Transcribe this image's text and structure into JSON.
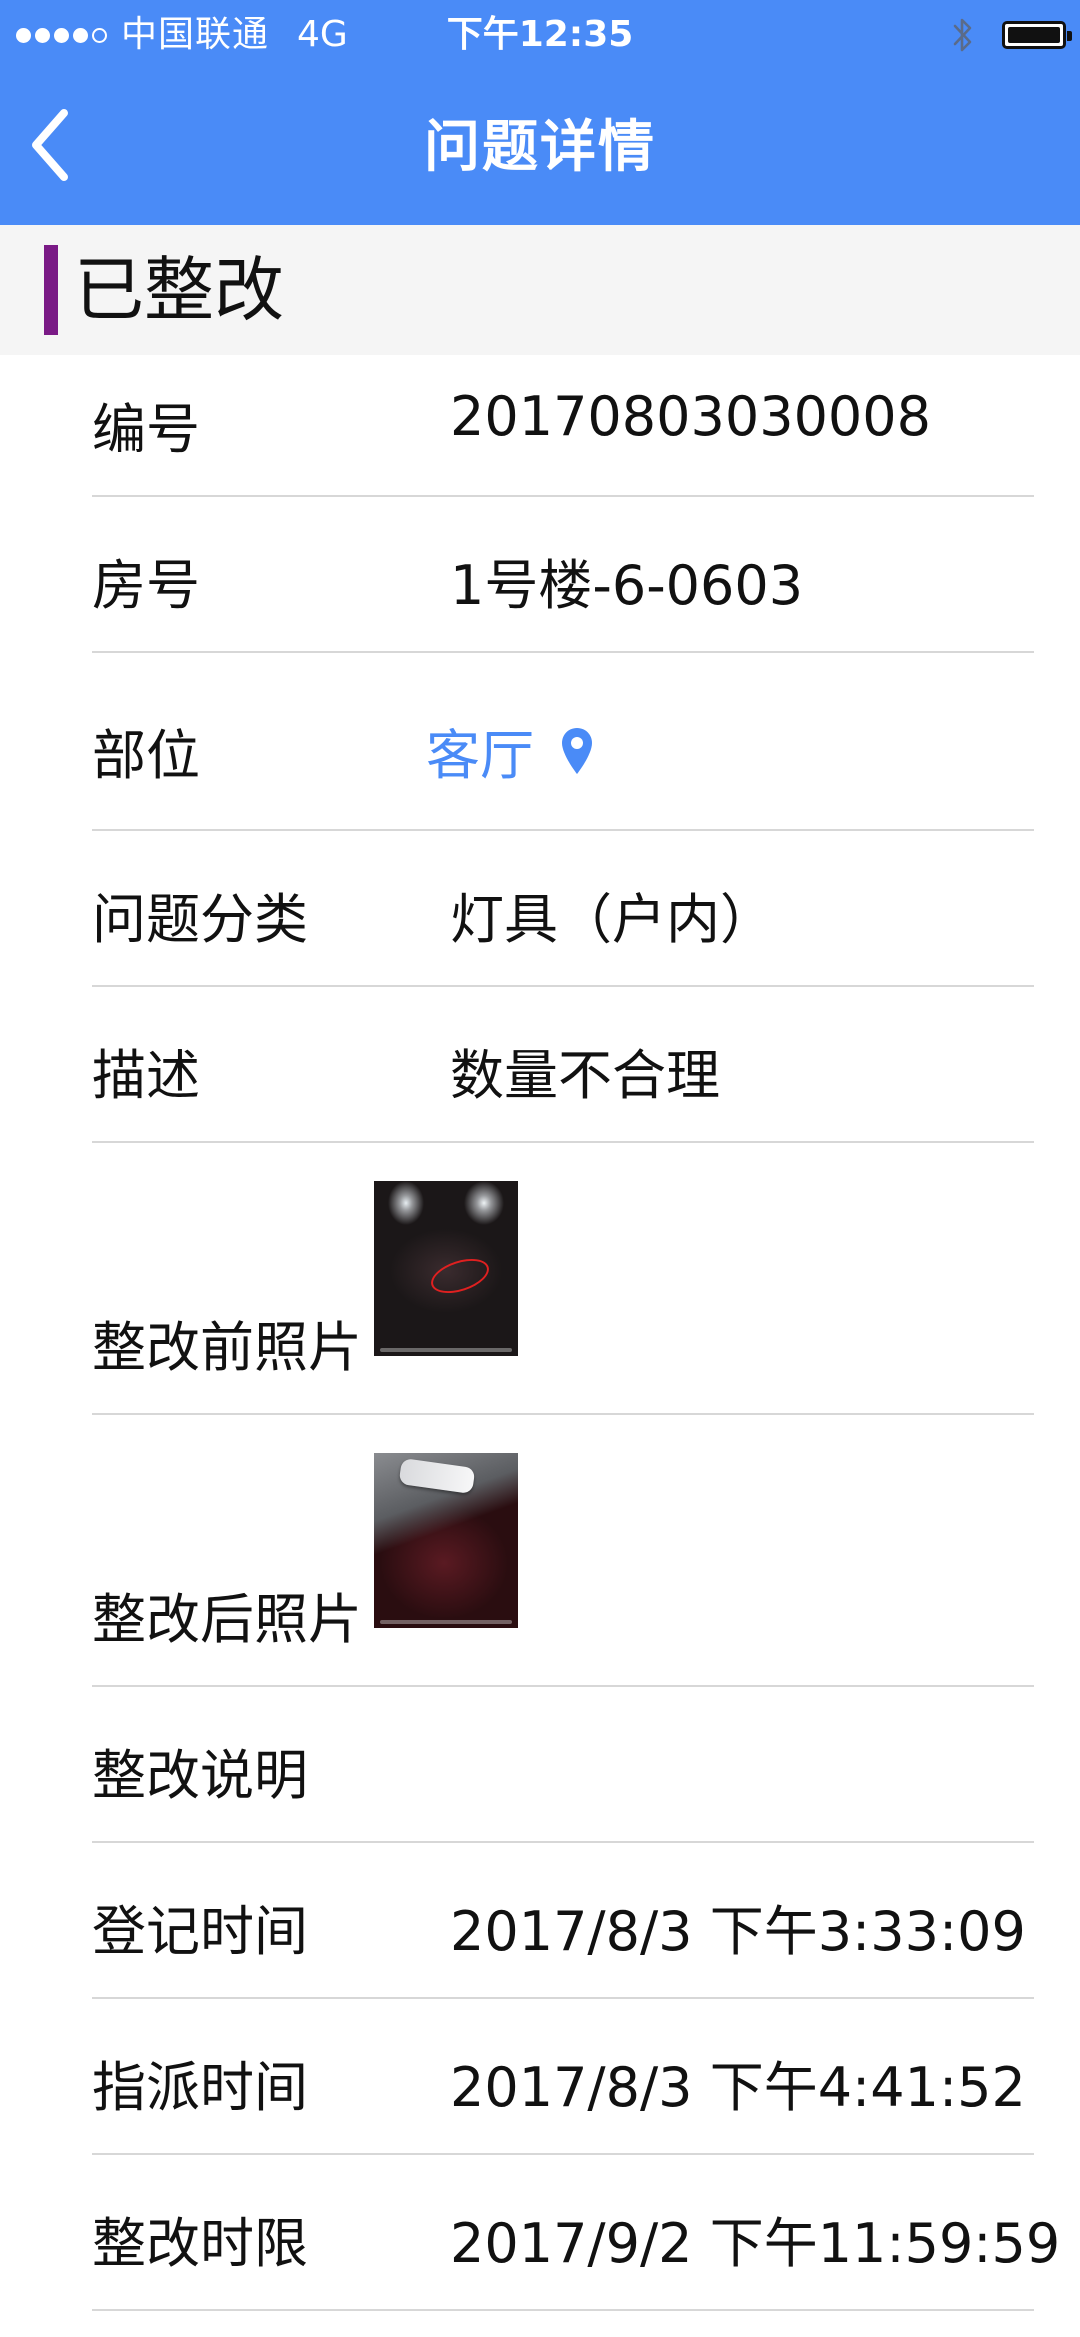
{
  "status_bar": {
    "signal_bars": 5,
    "signal_filled": 4,
    "carrier": "中国联通",
    "network": "4G",
    "time": "下午12:35",
    "battery_level": 1.0
  },
  "nav": {
    "title": "问题详情",
    "back_icon": "chevron-left-icon"
  },
  "colors": {
    "header_blue": "#4a8bf7",
    "section_accent": "#7a1a86",
    "link_blue": "#4a8bf7"
  },
  "section": {
    "title": "已整改"
  },
  "details": {
    "number_label": "编号",
    "number_value": "20170803030008",
    "room_label": "房号",
    "room_value": "1号楼-6-0603",
    "location_label": "部位",
    "location_value": "客厅",
    "location_icon": "location-pin-icon",
    "category_label": "问题分类",
    "category_value": "灯具（户内）",
    "description_label": "描述",
    "description_value": "数量不合理",
    "before_photo_label": "整改前照片",
    "after_photo_label": "整改后照片",
    "rectify_note_label": "整改说明",
    "rectify_note_value": "",
    "register_time_label": "登记时间",
    "register_time_value": "2017/8/3 下午3:33:09",
    "assign_time_label": "指派时间",
    "assign_time_value": "2017/8/3 下午4:41:52",
    "deadline_label": "整改时限",
    "deadline_value": "2017/9/2 下午11:59:59"
  }
}
